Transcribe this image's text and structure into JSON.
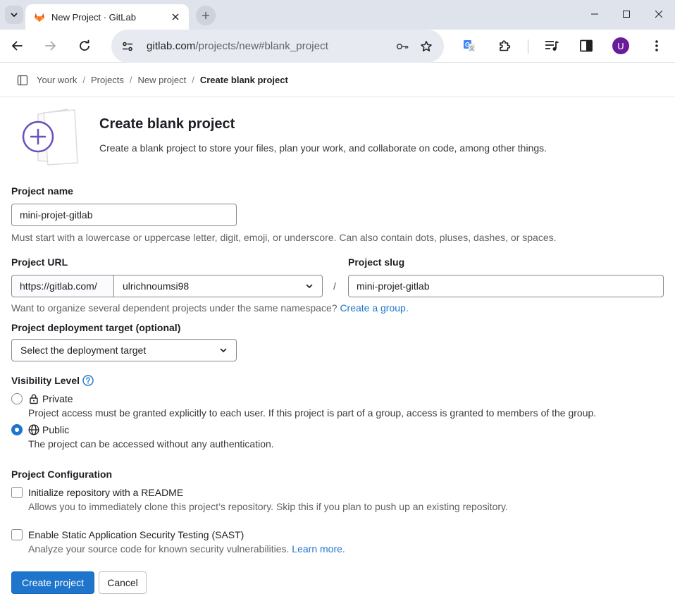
{
  "browser": {
    "tab_title": "New Project · GitLab",
    "url_host": "gitlab.com",
    "url_path": "/projects/new#blank_project",
    "profile_initial": "U"
  },
  "breadcrumb": {
    "items": [
      "Your work",
      "Projects",
      "New project",
      "Create blank project"
    ],
    "separator": "/"
  },
  "header": {
    "title": "Create blank project",
    "description": "Create a blank project to store your files, plan your work, and collaborate on code, among other things."
  },
  "form": {
    "project_name": {
      "label": "Project name",
      "value": "mini-projet-gitlab",
      "help": "Must start with a lowercase or uppercase letter, digit, emoji, or underscore. Can also contain dots, pluses, dashes, or spaces."
    },
    "project_url": {
      "label": "Project URL",
      "prefix": "https://gitlab.com/",
      "namespace": "ulrichnoumsi98",
      "separator": "/"
    },
    "project_slug": {
      "label": "Project slug",
      "value": "mini-projet-gitlab"
    },
    "group_help": {
      "text": "Want to organize several dependent projects under the same namespace?",
      "link": "Create a group."
    },
    "deployment_target": {
      "label": "Project deployment target (optional)",
      "placeholder": "Select the deployment target"
    },
    "visibility": {
      "label": "Visibility Level",
      "options": [
        {
          "label": "Private",
          "description": "Project access must be granted explicitly to each user. If this project is part of a group, access is granted to members of the group.",
          "checked": false,
          "icon": "lock-icon"
        },
        {
          "label": "Public",
          "description": "The project can be accessed without any authentication.",
          "checked": true,
          "icon": "globe-icon"
        }
      ]
    },
    "configuration": {
      "label": "Project Configuration",
      "options": [
        {
          "label": "Initialize repository with a README",
          "description": "Allows you to immediately clone this project’s repository. Skip this if you plan to push up an existing repository.",
          "checked": false
        },
        {
          "label": "Enable Static Application Security Testing (SAST)",
          "description": "Analyze your source code for known security vulnerabilities.",
          "link": "Learn more.",
          "checked": false
        }
      ]
    },
    "actions": {
      "create": "Create project",
      "cancel": "Cancel"
    }
  },
  "colors": {
    "primary": "#1f75cb",
    "avatar": "#6a1b9a",
    "gitlab_orange": "#e24329",
    "hero_purple": "#6b4fbb"
  }
}
